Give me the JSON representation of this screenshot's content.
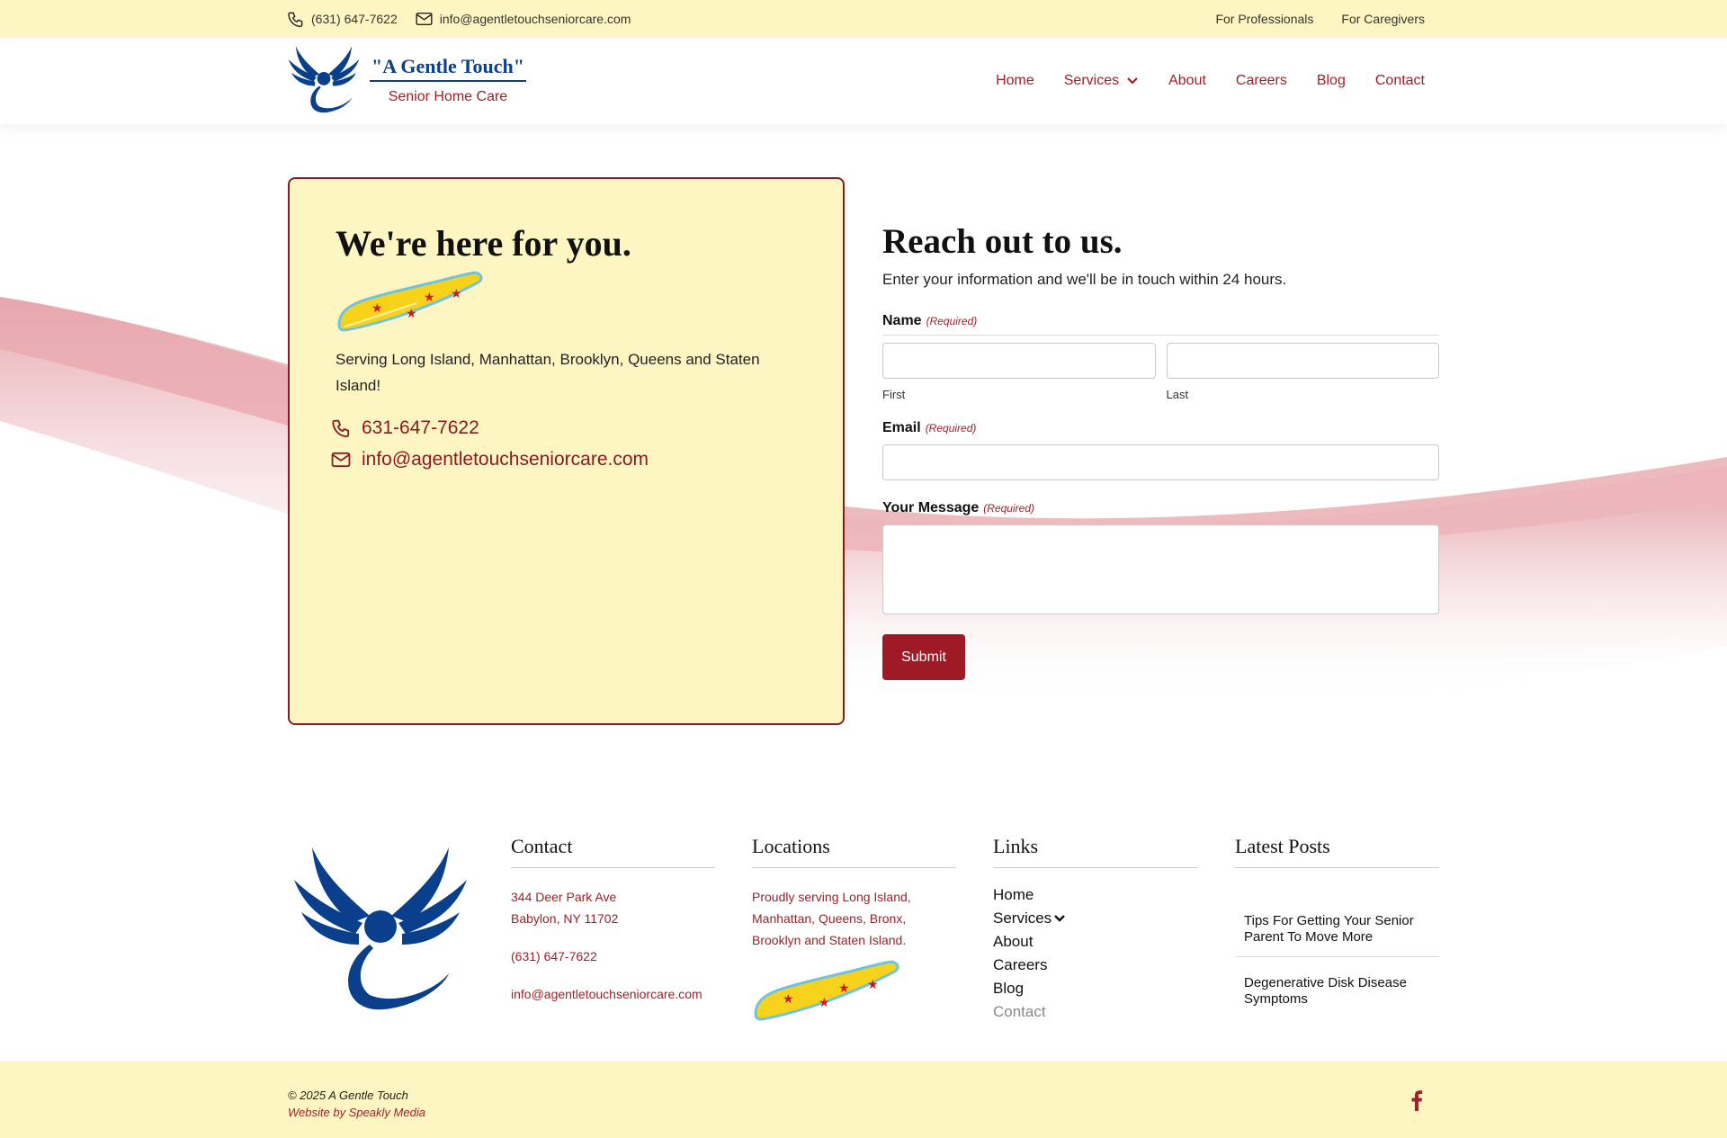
{
  "topbar": {
    "phone": "(631) 647-7622",
    "email": "info@agentletouchseniorcare.com",
    "links": [
      "For Professionals",
      "For Caregivers"
    ]
  },
  "header": {
    "brand_title": "\"A Gentle Touch\"",
    "brand_sub": "Senior Home Care",
    "nav": [
      "Home",
      "Services",
      "About",
      "Careers",
      "Blog",
      "Contact"
    ]
  },
  "card": {
    "heading": "We're here for you.",
    "serving": "Serving Long Island, Manhattan, Brooklyn, Queens and Staten Island!",
    "phone": "631-647-7622",
    "email": "info@agentletouchseniorcare.com"
  },
  "form": {
    "heading": "Reach out to us.",
    "subheading": "Enter your information and we'll be in touch within 24 hours.",
    "name_label": "Name",
    "required": "(Required)",
    "first_hint": "First",
    "last_hint": "Last",
    "email_label": "Email",
    "message_label": "Your Message",
    "submit": "Submit"
  },
  "footer": {
    "contact": {
      "heading": "Contact",
      "address1": "344 Deer Park Ave",
      "address2": "Babylon, NY 11702",
      "phone": "(631) 647-7622",
      "email": "info@agentletouchseniorcare.com"
    },
    "locations": {
      "heading": "Locations",
      "text": "Proudly serving Long Island, Manhattan, Queens, Bronx, Brooklyn and Staten Island."
    },
    "links": {
      "heading": "Links",
      "items": [
        "Home",
        "Services",
        "About",
        "Careers",
        "Blog",
        "Contact"
      ]
    },
    "posts": {
      "heading": "Latest Posts",
      "items": [
        "Tips For Getting Your Senior Parent To Move More",
        "Degenerative Disk Disease Symptoms"
      ]
    }
  },
  "bottombar": {
    "copyright": "© 2025 A Gentle Touch",
    "credit": "Website by Speakly Media"
  },
  "colors": {
    "accent": "#a02028",
    "cream": "#fdf6c3",
    "brand_blue": "#0a3f8c"
  }
}
